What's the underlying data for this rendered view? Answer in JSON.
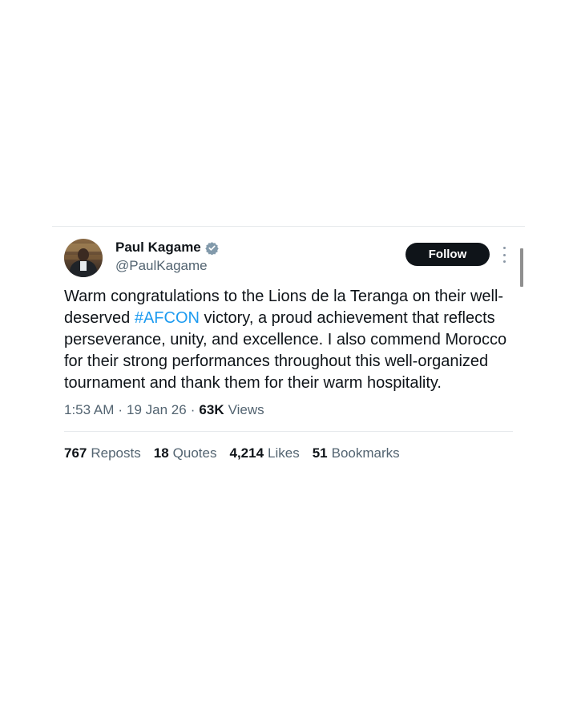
{
  "author": {
    "display_name": "Paul Kagame",
    "handle": "@PaulKagame",
    "verified": true,
    "verified_color": "#829aab"
  },
  "follow_label": "Follow",
  "tweet": {
    "text_part1": "Warm congratulations to the Lions de la Teranga on their well-deserved ",
    "hashtag": "#AFCON",
    "text_part2": " victory, a proud achievement that reflects perseverance, unity, and excellence. I also commend Morocco for their strong performances throughout this well-organized tournament and thank them for their warm hospitality."
  },
  "meta": {
    "time": "1:53 AM",
    "separator": "·",
    "date": "19 Jan 26",
    "views_count": "63K",
    "views_label": "Views"
  },
  "stats": [
    {
      "count": "767",
      "label": "Reposts"
    },
    {
      "count": "18",
      "label": "Quotes"
    },
    {
      "count": "4,214",
      "label": "Likes"
    },
    {
      "count": "51",
      "label": "Bookmarks"
    }
  ],
  "colors": {
    "accent": "#1d9bf0",
    "text": "#0f1419",
    "secondary": "#536471",
    "button_bg": "#0f1419"
  },
  "icons": [
    "avatar",
    "verified-badge-icon",
    "more-options-icon"
  ]
}
